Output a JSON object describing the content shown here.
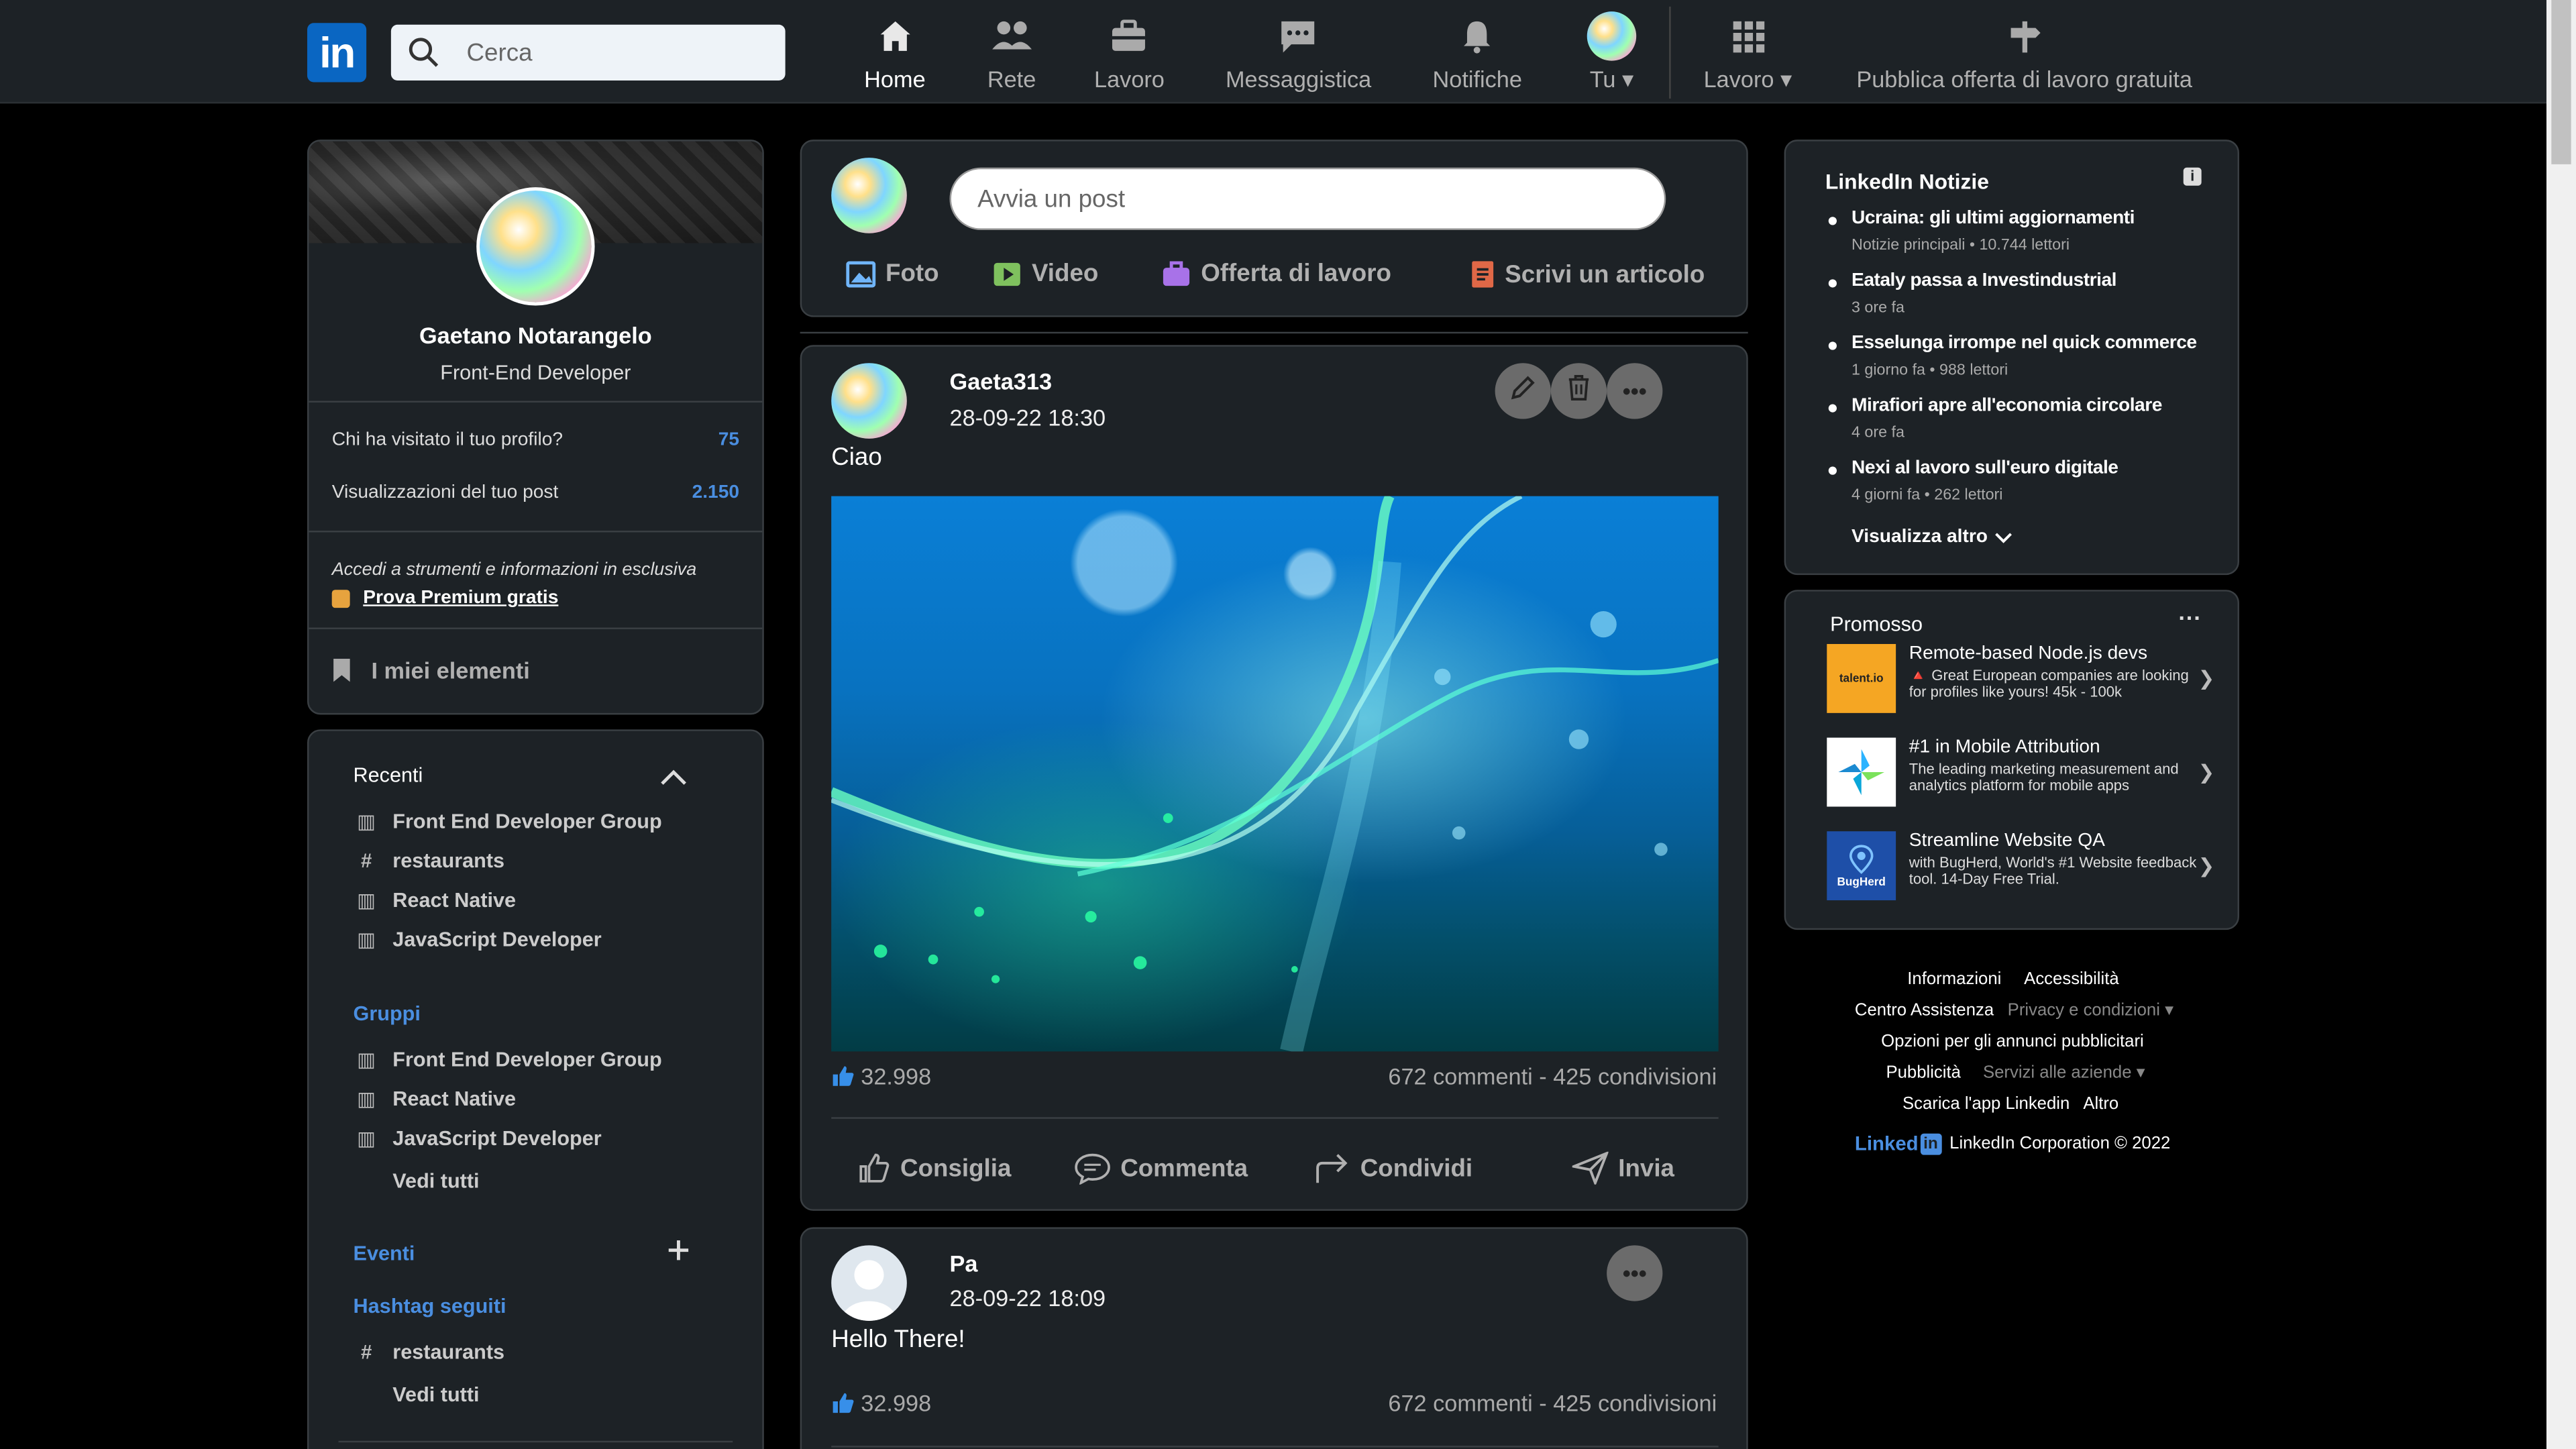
{
  "nav": {
    "logo": "in",
    "search_placeholder": "Cerca",
    "items": [
      {
        "label": "Home"
      },
      {
        "label": "Rete"
      },
      {
        "label": "Lavoro"
      },
      {
        "label": "Messaggistica"
      },
      {
        "label": "Notifiche"
      },
      {
        "label": "Tu ▾"
      },
      {
        "label": "Lavoro ▾"
      },
      {
        "label": "Pubblica offerta di lavoro gratuita"
      }
    ]
  },
  "profile": {
    "name": "Gaetano Notarangelo",
    "title": "Front-End Developer",
    "stats": [
      {
        "label": "Chi ha visitato il tuo profilo?",
        "value": "75"
      },
      {
        "label": "Visualizzazioni del tuo post",
        "value": "2.150"
      }
    ],
    "premium_text": "Accedi a strumenti e informazioni in esclusiva",
    "premium_link": "Prova Premium gratis",
    "my_items": "I miei elementi"
  },
  "left": {
    "recent_header": "Recenti",
    "recent": [
      "Front End Developer Group",
      "restaurants",
      "React Native",
      "JavaScript Developer"
    ],
    "groups_header": "Gruppi",
    "groups": [
      "Front End Developer Group",
      "React Native",
      "JavaScript Developer"
    ],
    "see_all": "Vedi tutti",
    "events_header": "Eventi",
    "hashtag_header": "Hashtag seguiti",
    "hashtags": [
      "restaurants"
    ],
    "see_all_2": "Vedi tutti"
  },
  "composer": {
    "placeholder": "Avvia un post",
    "actions": [
      "Foto",
      "Video",
      "Offerta di lavoro",
      "Scrivi un articolo"
    ]
  },
  "posts": [
    {
      "author": "Gaeta313",
      "date": "28-09-22 18:30",
      "text": "Ciao",
      "likes": "32.998",
      "stats": "672 commenti - 425 condivisioni",
      "actions": [
        "Consiglia",
        "Commenta",
        "Condividi",
        "Invia"
      ]
    },
    {
      "author": "Pa",
      "date": "28-09-22 18:09",
      "text": "Hello There!",
      "likes": "32.998",
      "stats": "672 commenti - 425 condivisioni"
    }
  ],
  "news": {
    "title": "LinkedIn Notizie",
    "items": [
      {
        "headline": "Ucraina: gli ultimi aggiornamenti",
        "meta": "Notizie principali • 10.744 lettori"
      },
      {
        "headline": "Eataly passa a Investindustrial",
        "meta": "3 ore fa"
      },
      {
        "headline": "Esselunga irrompe nel quick commerce",
        "meta": "1 giorno fa • 988 lettori"
      },
      {
        "headline": "Mirafiori apre all'economia circolare",
        "meta": "4 ore fa"
      },
      {
        "headline": "Nexi al lavoro sull'euro digitale",
        "meta": "4 giorni fa • 262 lettori"
      }
    ],
    "more": "Visualizza altro"
  },
  "promo": {
    "title": "Promosso",
    "items": [
      {
        "logo": "talent.io",
        "title": "Remote-based Node.js devs",
        "desc": "🔺 Great European companies are looking for profiles like yours! 45k - 100k"
      },
      {
        "logo": "",
        "title": "#1 in Mobile Attribution",
        "desc": "The leading marketing measurement and analytics platform for mobile apps"
      },
      {
        "logo": "BugHerd",
        "title": "Streamline Website QA",
        "desc": "with BugHerd, World's #1 Website feedback tool. 14-Day Free Trial."
      }
    ]
  },
  "footer": {
    "links": [
      "Informazioni",
      "Accessibilità",
      "Centro Assistenza",
      "Privacy e condizioni ▾",
      "Opzioni per gli annunci pubblicitari",
      "Pubblicità",
      "Servizi alle aziende ▾",
      "Scarica l'app Linkedin",
      "Altro"
    ],
    "brand": "Linked",
    "copyright": "LinkedIn Corporation © 2022"
  }
}
